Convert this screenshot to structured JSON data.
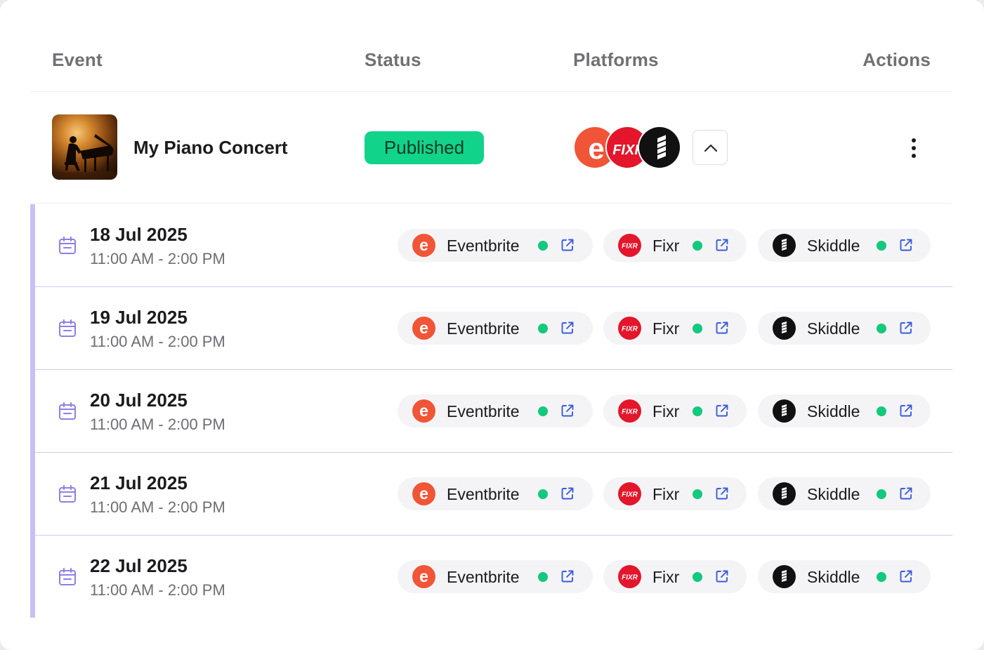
{
  "table": {
    "headers": {
      "event": "Event",
      "status": "Status",
      "platforms": "Platforms",
      "actions": "Actions"
    }
  },
  "event": {
    "title": "My Piano Concert",
    "thumbnail_icon": "piano-concert-image",
    "status": "Published",
    "status_color": "#12d38a",
    "platform_icons": [
      "eventbrite-logo-icon",
      "fixr-logo-icon",
      "skiddle-logo-icon"
    ],
    "collapse_icon": "chevron-up-icon",
    "actions_icon": "more-vertical-icon"
  },
  "platforms": {
    "eventbrite": {
      "name": "Eventbrite",
      "color": "#f05537"
    },
    "fixr": {
      "name": "Fixr",
      "logo_text": "FIXR",
      "color": "#e3162b"
    },
    "skiddle": {
      "name": "Skiddle",
      "color": "#111111"
    },
    "status_dot_color": "#12c97d"
  },
  "dates": [
    {
      "date": "18 Jul 2025",
      "time": "11:00 AM - 2:00 PM"
    },
    {
      "date": "19 Jul 2025",
      "time": "11:00 AM - 2:00 PM"
    },
    {
      "date": "20 Jul 2025",
      "time": "11:00 AM - 2:00 PM"
    },
    {
      "date": "21 Jul 2025",
      "time": "11:00 AM - 2:00 PM"
    },
    {
      "date": "22 Jul 2025",
      "time": "11:00 AM - 2:00 PM"
    }
  ],
  "colors": {
    "accent": "#c8c0f5",
    "calendar_icon": "#8f7ee6",
    "link_icon": "#3b5bdb"
  }
}
